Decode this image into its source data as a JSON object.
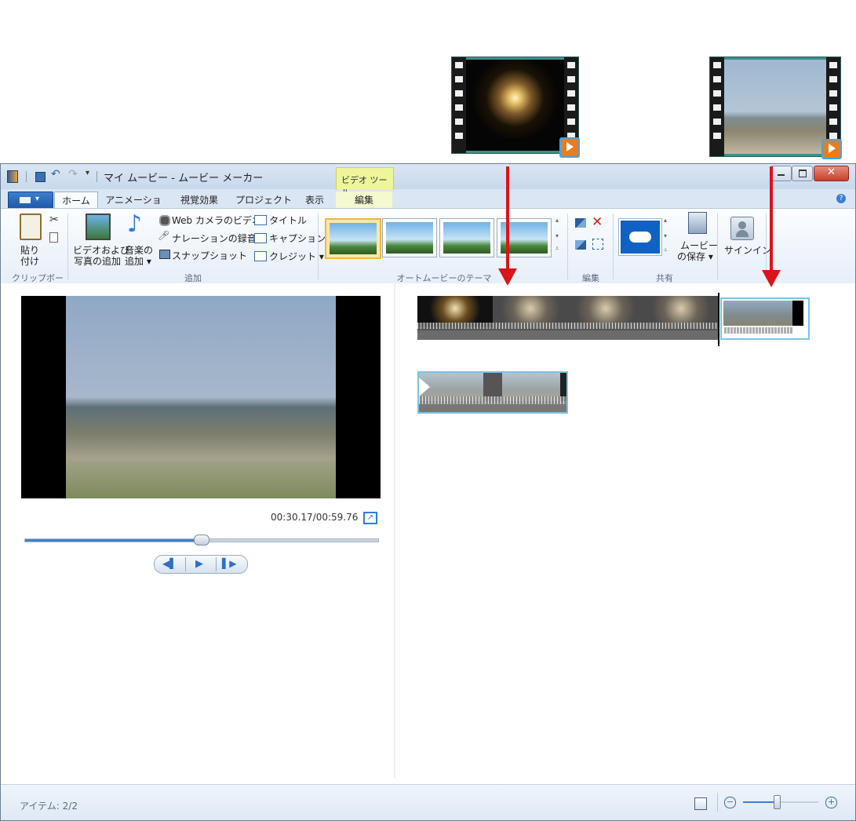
{
  "window": {
    "title": "マイ ムービー - ムービー メーカー",
    "context_tab": "ビデオ ツール"
  },
  "tabs": [
    "ホーム",
    "アニメーション",
    "視覚効果",
    "プロジェクト",
    "表示",
    "編集"
  ],
  "clipboard": {
    "paste_line1": "貼り",
    "paste_line2": "付け",
    "group_label": "クリップボード"
  },
  "add": {
    "add_videos_line1": "ビデオおよび",
    "add_videos_line2": "写真の追加",
    "add_music_line1": "音楽の",
    "add_music_line2": "追加 ▾",
    "webcam": "Web カメラのビデオ",
    "narration": "ナレーションの録音 ▾",
    "snapshot": "スナップショット",
    "title": "タイトル",
    "caption": "キャプション",
    "credits": "クレジット ▾",
    "group_label": "追加"
  },
  "themes": {
    "group_label": "オートムービーのテーマ"
  },
  "edit": {
    "group_label": "編集"
  },
  "share": {
    "save_movie_line1": "ムービー",
    "save_movie_line2": "の保存 ▾",
    "group_label": "共有"
  },
  "signin": {
    "label": "サインイン"
  },
  "preview": {
    "time": "00:30.17/00:59.76",
    "seek_position": 0.5
  },
  "status": {
    "items": "アイテム: 2/2",
    "zoom": 0.45
  },
  "colors": {
    "accent": "#3f7fce",
    "arrow": "#d9141a",
    "context_tab": "#eef59a",
    "selection": "#7cc2e6"
  }
}
